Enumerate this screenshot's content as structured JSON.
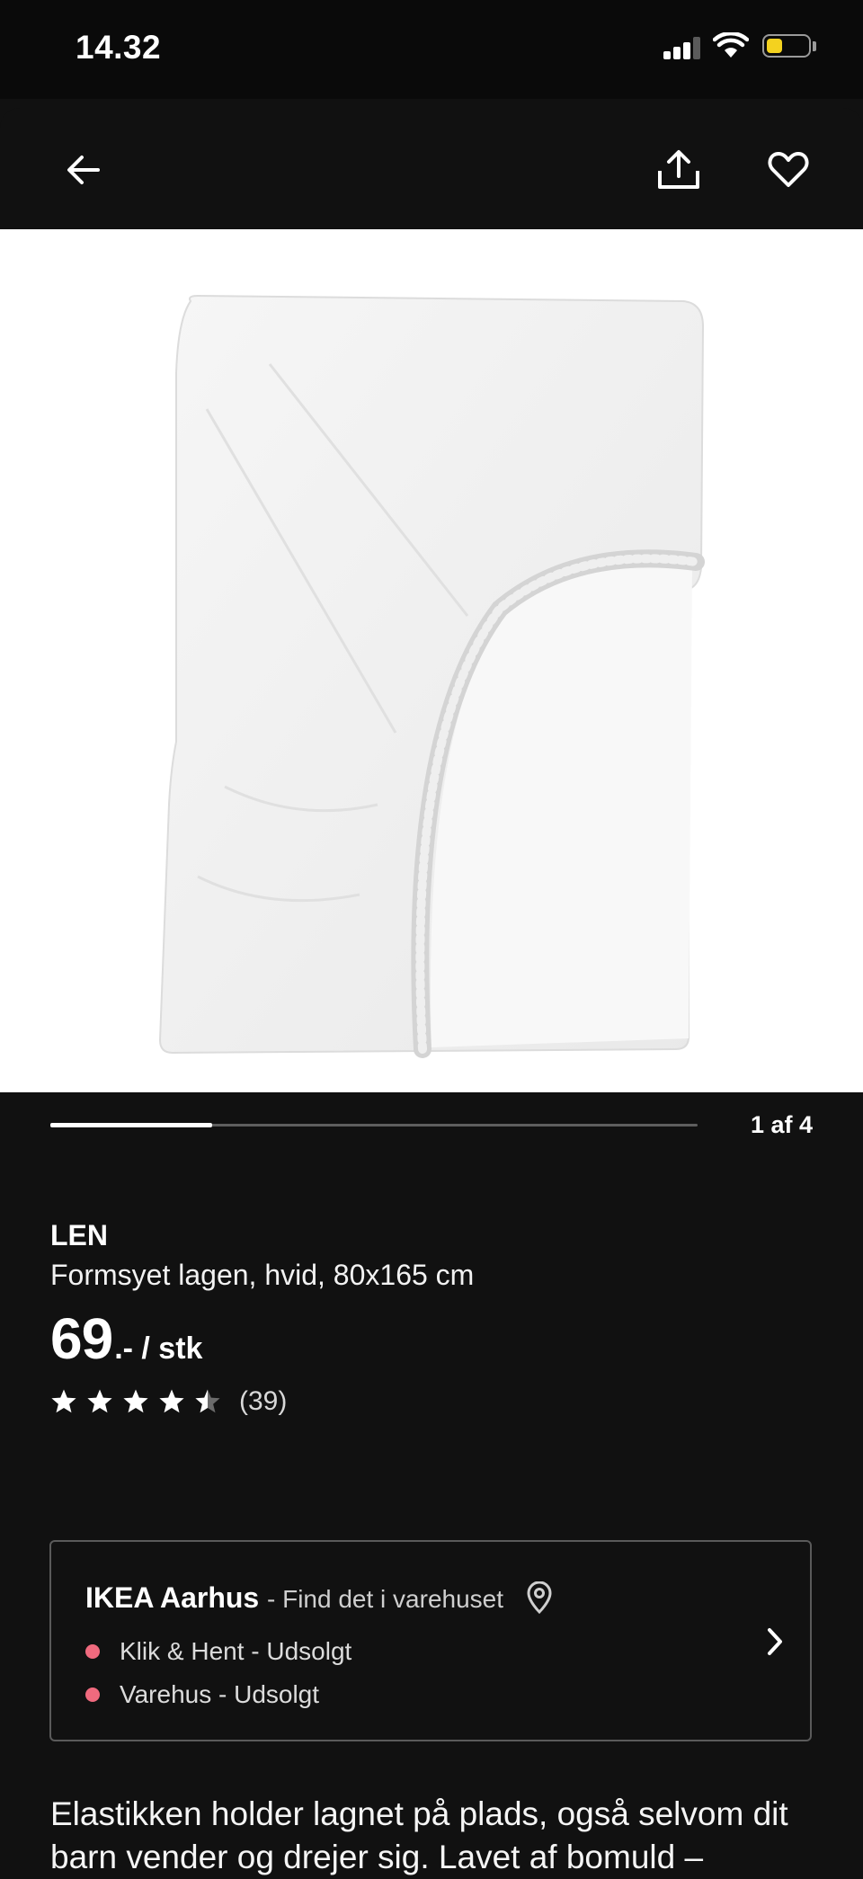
{
  "status_bar": {
    "time": "14.32",
    "battery_color": "#f4d21f"
  },
  "nav": {
    "back_icon": "arrow-left-icon",
    "share_icon": "share-icon",
    "favorite_icon": "heart-icon"
  },
  "gallery": {
    "page_indicator": "1 af 4",
    "progress_fraction": 0.25
  },
  "product": {
    "name": "LEN",
    "description": "Formsyet lagen, hvid, 80x165 cm",
    "price_int": "69",
    "price_suffix": ".- / stk",
    "rating_value": 4.5,
    "rating_count": "(39)"
  },
  "store": {
    "name": "IKEA Aarhus",
    "subtitle": "- Find det i varehuset",
    "availability": [
      {
        "label": "Klik & Hent - Udsolgt",
        "status_color": "#f06a7e"
      },
      {
        "label": "Varehus - Udsolgt",
        "status_color": "#f06a7e"
      }
    ]
  },
  "body_text": "Elastikken holder lagnet på plads, også selvom dit barn vender og drejer sig. Lavet af bomuld –"
}
